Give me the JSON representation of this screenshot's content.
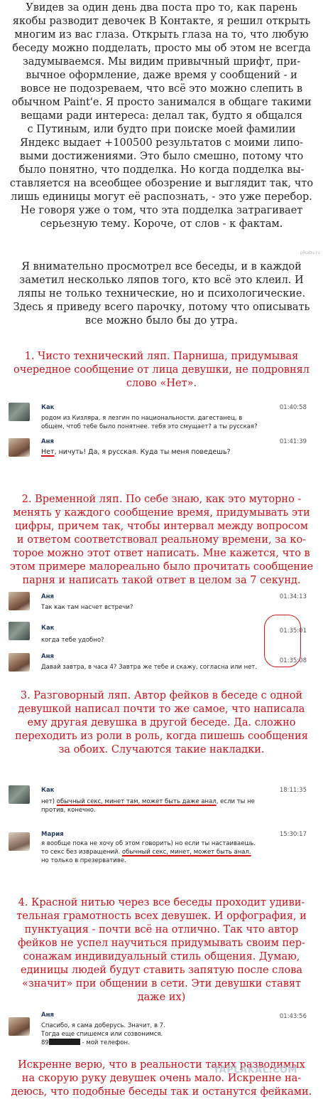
{
  "watermark_top": "pikabu.ru",
  "watermark_bottom": "YAPLAKAL.COM",
  "intro": [
    "Увидев за один день два поста про то, как парень",
    "якобы разводит девочек В Контакте, я решил открыть",
    "многим из вас глаза. Открыть глаза на то, что любую",
    "беседу можно подделать, просто мы об этом не всегда",
    "задумываемся. Мы видим привычный шрифт, при-",
    "вычное оформление, даже время у сообщений - и",
    "вовсе не подозреваем, что всё это можно слепить в",
    "обычном Paint'е. Я просто занимался в общаге такими",
    "вещами ради интереса: делал так, будто я общался",
    "с Путиным, или будто при поиске моей фамилии",
    "Яндекс выдает +100500 результатов с моими липо-",
    "выми достижениями. Это было смешно, потому что",
    "было понятно, что подделка. Но когда подделка вы-",
    "ставляется на всеобщее обозрение и выглядит так, что",
    "лишь единицы могут её распознать, - это уже перебор.",
    "Не говоря уже о том, что эта подделка затрагивает",
    "серьезную тему. Короче, от слов - к фактам."
  ],
  "intro2": [
    "Я внимательно просмотрел все беседы, и в каждой",
    "заметил несколько ляпов того, кто всё это клеил. И",
    "ляпы не только технические, но и психологические.",
    "Здесь я приведу всего парочку, потому что описывать",
    "все можно было бы до утра."
  ],
  "point1": [
    "1. Чисто технический ляп. Парниша, придумывая",
    "очередное сообщение от лица девушки, не подровнял",
    "слово «Нет»."
  ],
  "chat1": {
    "m1_name": "Как",
    "m1_time": "01:40:58",
    "m1_line1": "родом из Кизляра, я лезгин по национальности. дагестанец, в",
    "m1_line2": "общем, чтоб тебе было понятнее. тебя это смущает? а ты русская?",
    "m2_name": "Аня",
    "m2_time": "01:41:39",
    "m2_word": "Нет",
    "m2_rest": ", ничуть! Да, я русская. Куда ты меня поведешь?"
  },
  "point2": [
    "2. Временной ляп. По себе знаю, как это муторно -",
    "менять у каждого сообщение время, придумывать эти",
    "цифры, причем так, чтобы интервал между вопросом",
    "и ответом соответствовал реальному времени, за ко-",
    "торое можно этот ответ написать. Мне кажется, что в",
    "этом примере малореально было прочитать сообщение",
    "парня и написать такой ответ в целом за 7 секунд."
  ],
  "chat2": {
    "m1_name": "Аня",
    "m1_time": "01:34:13",
    "m1_text": "Так как там насчет встречи?",
    "m2_name": "Как",
    "m2_time": "01:35:01",
    "m2_text": "когда тебе удобно?",
    "m3_name": "Аня",
    "m3_time": "01:35:08",
    "m3_text": "Давай завтра, в часа 4? Завтра же тебе и скажу, согласна или нет."
  },
  "point3": [
    "3. Разговорный ляп. Автор фейков в беседе с одной",
    "девушкой написал почти то же самое, что написала",
    "ему другая девушка в другой беседе. Да. сложно",
    "переходить из роли в роль, когда пишешь сообщения",
    "за обоих. Случаются такие накладки."
  ],
  "chat3": {
    "m1_name": "Как",
    "m1_time": "18:11:35",
    "m1_pre": "нет) ",
    "m1_ul": "обычный секс, минет там, может быть даже анал",
    "m1_post": ", если ты не",
    "m1_line2": "против, конечно.",
    "m2_name": "Мария",
    "m2_time": "15:30:17",
    "m2_line1": "я вообще пока не хочу об этом говорить) но если ты настаиваешь.",
    "m2_pre": "то секс без извращений. ",
    "m2_ul": "обычный секс, минет, может быть анал.",
    "m2_line3": "но только в презервативе."
  },
  "point4": [
    "4. Красной нитью через все беседы проходит удиви-",
    "тельная грамотность всех девушек. И орфография, и",
    "пунктуация - почти всё на отлично. Так что автор",
    "фейков не успел научиться придумывать своим пер-",
    "сонажам индивидуальный стиль общения. Думаю,",
    "единицы людей будут ставить запятую после слова",
    "«значит» при общении в сети. Эти девушки ставят",
    "даже их)"
  ],
  "chat4": {
    "m1_name": "Аня",
    "m1_time": "01:43:56",
    "m1_line1": "Спасибо, я сама доберусь. Значит, в 7.",
    "m1_line2": "Тогда еще спишемся или созвонимся.",
    "m1_line3_prefix": "89",
    "m1_line3_suffix": " - мой телефон."
  },
  "outro": [
    "Искренне верю, что в реальности таких разводимых",
    "на скорую руку девушек очень мало. Искренне на-",
    "деюсь, что подобные беседы так и останутся фейками."
  ]
}
